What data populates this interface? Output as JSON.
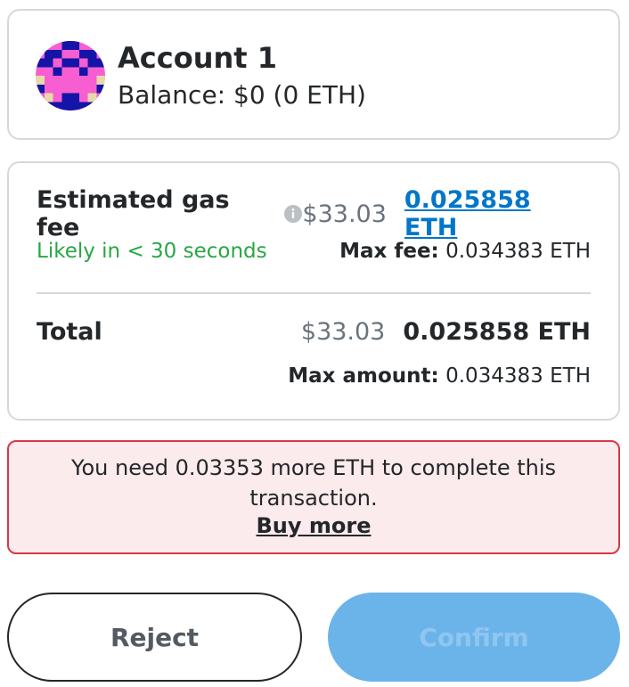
{
  "account": {
    "name": "Account 1",
    "balance": "Balance: $0 (0 ETH)",
    "avatar_icon": "account-identicon"
  },
  "fees": {
    "estimated_label": "Estimated gas fee",
    "estimated_usd": "$33.03",
    "estimated_eth": "0.025858 ETH",
    "timing": "Likely in < 30 seconds",
    "max_fee_label": "Max fee:",
    "max_fee_value": "0.034383 ETH",
    "total_label": "Total",
    "total_usd": "$33.03",
    "total_eth": "0.025858 ETH",
    "max_amount_label": "Max amount:",
    "max_amount_value": "0.034383 ETH"
  },
  "alert": {
    "message": "You need 0.03353 more ETH to complete this transaction.",
    "action": "Buy more"
  },
  "buttons": {
    "reject": "Reject",
    "confirm": "Confirm"
  },
  "colors": {
    "link": "#0376c9",
    "success": "#28a745",
    "error_border": "#d73847",
    "error_bg": "#fcebec",
    "confirm_disabled": "#6ab4ea"
  }
}
